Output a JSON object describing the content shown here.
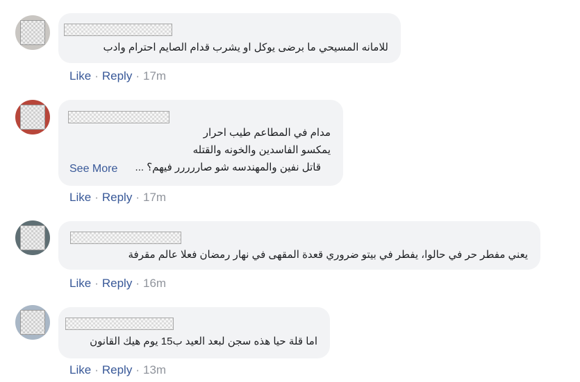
{
  "comments": [
    {
      "lines": [
        "للامانه المسيحي ما برضى يوكل او يشرب قدام الصايم احترام وادب"
      ],
      "see_more": "",
      "like": "Like",
      "reply": "Reply",
      "time": "17m"
    },
    {
      "lines": [
        "مدام في المطاعم طيب احرار",
        "يمكسو الفاسدين والخونه والقتله",
        "قاتل نفين والمهندسه شو صاررررر فيهم؟ ..."
      ],
      "see_more": "See More",
      "like": "Like",
      "reply": "Reply",
      "time": "17m"
    },
    {
      "lines": [
        "يعني مفطر حر في حالوا، يفطر في بيتو ضروري قعدة المقهى في نهار رمضان فعلا عالم مقرفة"
      ],
      "see_more": "",
      "like": "Like",
      "reply": "Reply",
      "time": "16m"
    },
    {
      "lines": [
        "اما قلة حيا هذه سجن لبعد العيد ب15 يوم هيك القانون"
      ],
      "see_more": "",
      "like": "Like",
      "reply": "Reply",
      "time": "13m"
    }
  ],
  "separator": "·"
}
